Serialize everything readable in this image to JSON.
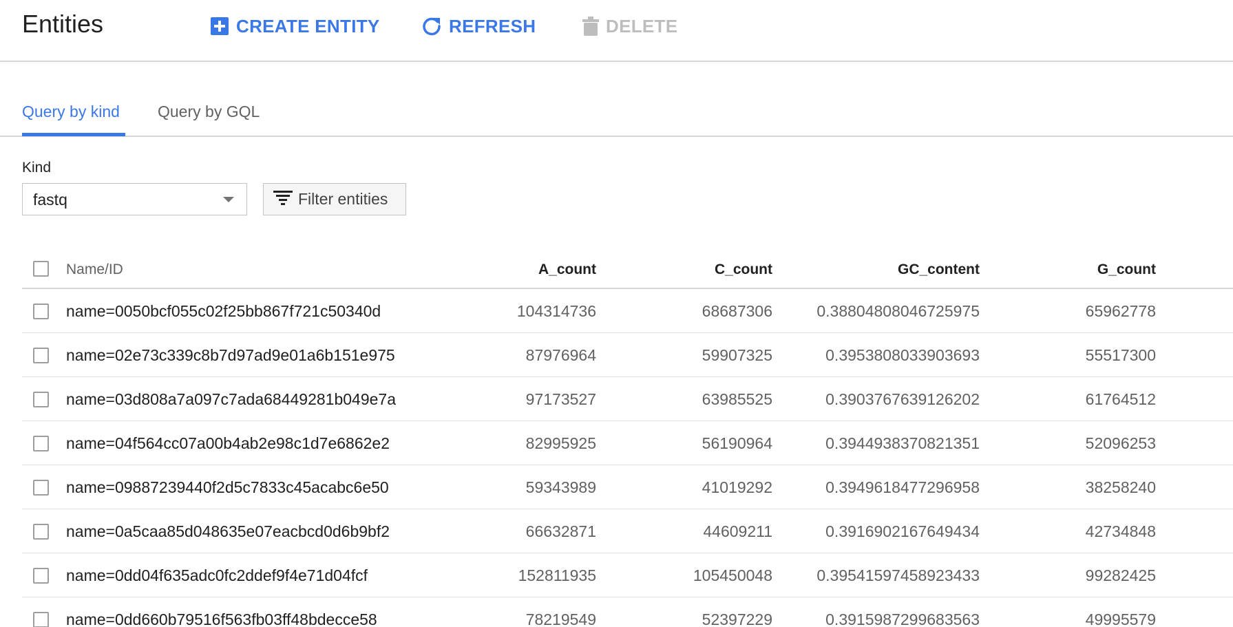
{
  "header": {
    "title": "Entities",
    "create_label": "CREATE ENTITY",
    "refresh_label": "REFRESH",
    "delete_label": "DELETE"
  },
  "tabs": [
    {
      "label": "Query by kind",
      "active": true
    },
    {
      "label": "Query by GQL",
      "active": false
    }
  ],
  "kind": {
    "label": "Kind",
    "selected": "fastq"
  },
  "filter": {
    "label": "Filter entities"
  },
  "table": {
    "columns": [
      "Name/ID",
      "A_count",
      "C_count",
      "GC_content",
      "G_count"
    ],
    "rows": [
      {
        "name": "name=0050bcf055c02f25bb867f721c50340d",
        "a_count": "104314736",
        "c_count": "68687306",
        "gc_content": "0.38804808046725975",
        "g_count": "65962778"
      },
      {
        "name": "name=02e73c339c8b7d97ad9e01a6b151e975",
        "a_count": "87976964",
        "c_count": "59907325",
        "gc_content": "0.3953808033903693",
        "g_count": "55517300"
      },
      {
        "name": "name=03d808a7a097c7ada68449281b049e7a",
        "a_count": "97173527",
        "c_count": "63985525",
        "gc_content": "0.3903767639126202",
        "g_count": "61764512"
      },
      {
        "name": "name=04f564cc07a00b4ab2e98c1d7e6862e2",
        "a_count": "82995925",
        "c_count": "56190964",
        "gc_content": "0.3944938370821351",
        "g_count": "52096253"
      },
      {
        "name": "name=09887239440f2d5c7833c45acabc6e50",
        "a_count": "59343989",
        "c_count": "41019292",
        "gc_content": "0.3949618477296958",
        "g_count": "38258240"
      },
      {
        "name": "name=0a5caa85d048635e07eacbcd0d6b9bf2",
        "a_count": "66632871",
        "c_count": "44609211",
        "gc_content": "0.3916902167649434",
        "g_count": "42734848"
      },
      {
        "name": "name=0dd04f635adc0fc2ddef9f4e71d04fcf",
        "a_count": "152811935",
        "c_count": "105450048",
        "gc_content": "0.39541597458923433",
        "g_count": "99282425"
      },
      {
        "name": "name=0dd660b79516f563fb03ff48bdecce58",
        "a_count": "78219549",
        "c_count": "52397229",
        "gc_content": "0.3915987299683563",
        "g_count": "49995579"
      }
    ]
  },
  "icons": {
    "create": "plus-box-icon",
    "refresh": "refresh-icon",
    "delete": "trash-icon",
    "filter": "filter-icon",
    "dropdown": "caret-down-icon"
  },
  "colors": {
    "accent": "#3b78e7",
    "disabled": "#bdbdbd"
  }
}
